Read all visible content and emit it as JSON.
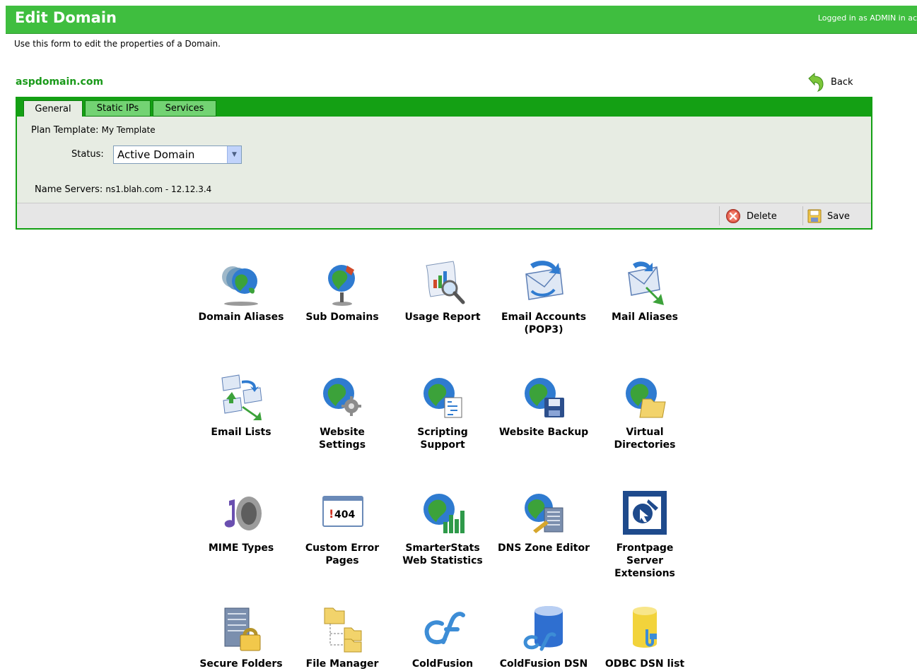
{
  "header": {
    "title": "Edit Domain",
    "login": "Logged in as ADMIN in ac"
  },
  "intro": "Use this form to edit the properties of a Domain.",
  "domain_name": "aspdomain.com",
  "back_label": "Back",
  "tabs": [
    {
      "label": "General",
      "active": true
    },
    {
      "label": "Static IPs",
      "active": false
    },
    {
      "label": "Services",
      "active": false
    }
  ],
  "form": {
    "plan_template_label": "Plan Template:",
    "plan_template_value": "My Template",
    "status_label": "Status:",
    "status_value": "Active Domain",
    "name_servers_label": "Name Servers:",
    "name_servers_value": "ns1.blah.com - 12.12.3.4"
  },
  "actions": {
    "delete": "Delete",
    "save": "Save"
  },
  "grid": [
    {
      "label": "Domain Aliases",
      "icon": "domain-aliases-icon"
    },
    {
      "label": "Sub Domains",
      "icon": "sub-domains-icon"
    },
    {
      "label": "Usage Report",
      "icon": "usage-report-icon"
    },
    {
      "label": "Email Accounts\n(POP3)",
      "icon": "email-accounts-icon"
    },
    {
      "label": "Mail Aliases",
      "icon": "mail-aliases-icon"
    },
    {
      "label": "Email Lists",
      "icon": "email-lists-icon"
    },
    {
      "label": "Website\nSettings",
      "icon": "website-settings-icon"
    },
    {
      "label": "Scripting\nSupport",
      "icon": "scripting-support-icon"
    },
    {
      "label": "Website Backup",
      "icon": "website-backup-icon"
    },
    {
      "label": "Virtual\nDirectories",
      "icon": "virtual-directories-icon"
    },
    {
      "label": "MIME Types",
      "icon": "mime-types-icon"
    },
    {
      "label": "Custom Error\nPages",
      "icon": "custom-error-pages-icon"
    },
    {
      "label": "SmarterStats\nWeb Statistics",
      "icon": "smarterstats-icon"
    },
    {
      "label": "DNS Zone Editor",
      "icon": "dns-zone-editor-icon"
    },
    {
      "label": "Frontpage\nServer\nExtensions",
      "icon": "frontpage-icon"
    },
    {
      "label": "Secure Folders",
      "icon": "secure-folders-icon"
    },
    {
      "label": "File Manager",
      "icon": "file-manager-icon"
    },
    {
      "label": "ColdFusion",
      "icon": "coldfusion-icon"
    },
    {
      "label": "ColdFusion DSN",
      "icon": "coldfusion-dsn-icon"
    },
    {
      "label": "ODBC DSN list",
      "icon": "odbc-dsn-icon"
    }
  ],
  "error_code": "404",
  "colors": {
    "header": "#3fbe3f",
    "tabbar": "#14a014",
    "domain": "#1a9a1a",
    "panel": "#e7ece3"
  }
}
